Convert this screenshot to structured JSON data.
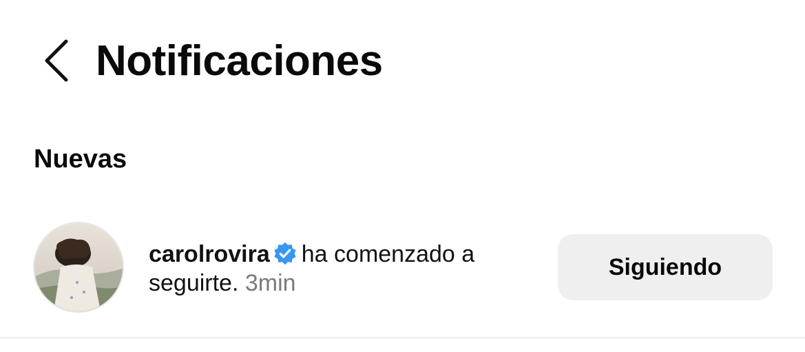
{
  "header": {
    "back_icon": "chevron-left-icon",
    "title": "Notificaciones"
  },
  "sections": [
    {
      "title": "Nuevas",
      "items": [
        {
          "avatar_icon": "avatar",
          "username": "carolrovira",
          "verified_icon": "verified-badge-icon",
          "message": "ha comenzado a seguirte.",
          "time": "3min",
          "button_label": "Siguiendo"
        }
      ]
    }
  ],
  "colors": {
    "text": "#111111",
    "muted": "#7a7a7a",
    "verified": "#3897f0",
    "button_bg": "#efefef",
    "divider": "#dbdbdb"
  }
}
